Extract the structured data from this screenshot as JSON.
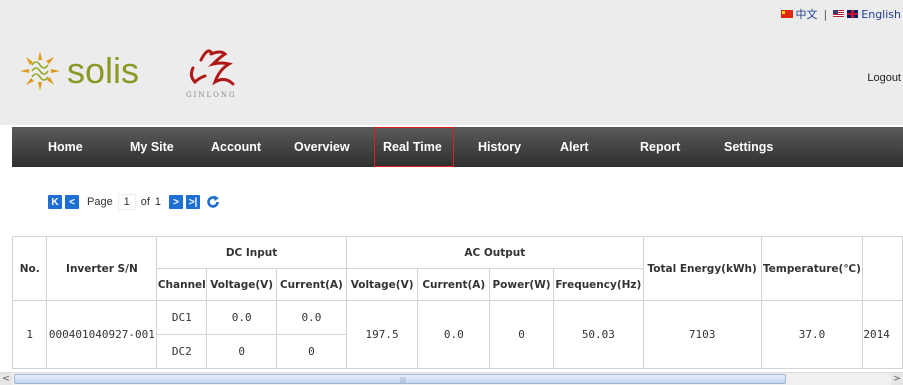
{
  "language_bar": {
    "chinese": "中文",
    "separator": "|",
    "english": "English"
  },
  "logo": {
    "brand": "solis",
    "sub_brand": "GINLONG"
  },
  "header": {
    "logout": "Logout"
  },
  "nav": {
    "items": [
      "Home",
      "My Site",
      "Account",
      "Overview",
      "Real Time",
      "History",
      "Alert",
      "Report",
      "Settings"
    ],
    "active": "Real Time",
    "active_border_color": "#d9231d"
  },
  "pager": {
    "page_label": "Page",
    "page_value": "1",
    "of_label": "of",
    "total_pages": "1"
  },
  "table": {
    "headers": {
      "no": "No.",
      "inverter_sn": "Inverter S/N",
      "dc_input": "DC Input",
      "ac_output": "AC Output",
      "total_energy": "Total Energy(kWh)",
      "temperature": "Temperature(℃)",
      "channel": "Channel",
      "dc_voltage": "Voltage(V)",
      "dc_current": "Current(A)",
      "ac_voltage": "Voltage(V)",
      "ac_current": "Current(A)",
      "power": "Power(W)",
      "frequency": "Frequency(Hz)"
    },
    "row": {
      "no": "1",
      "inverter_sn": "000401040927-001",
      "dc": [
        {
          "channel": "DC1",
          "voltage": "0.0",
          "current": "0.0"
        },
        {
          "channel": "DC2",
          "voltage": "0",
          "current": "0"
        }
      ],
      "ac_voltage": "197.5",
      "ac_current": "0.0",
      "power": "0",
      "frequency": "50.03",
      "total_energy": "7103",
      "temperature": "37.0",
      "time": "2014"
    }
  },
  "colors": {
    "accent_blue": "#1e6fd3",
    "brand_green": "#8c9826",
    "nav_dark": "#2f2f2f"
  },
  "icons": [
    "first-page-icon",
    "prev-page-icon",
    "next-page-icon",
    "last-page-icon",
    "refresh-icon"
  ]
}
